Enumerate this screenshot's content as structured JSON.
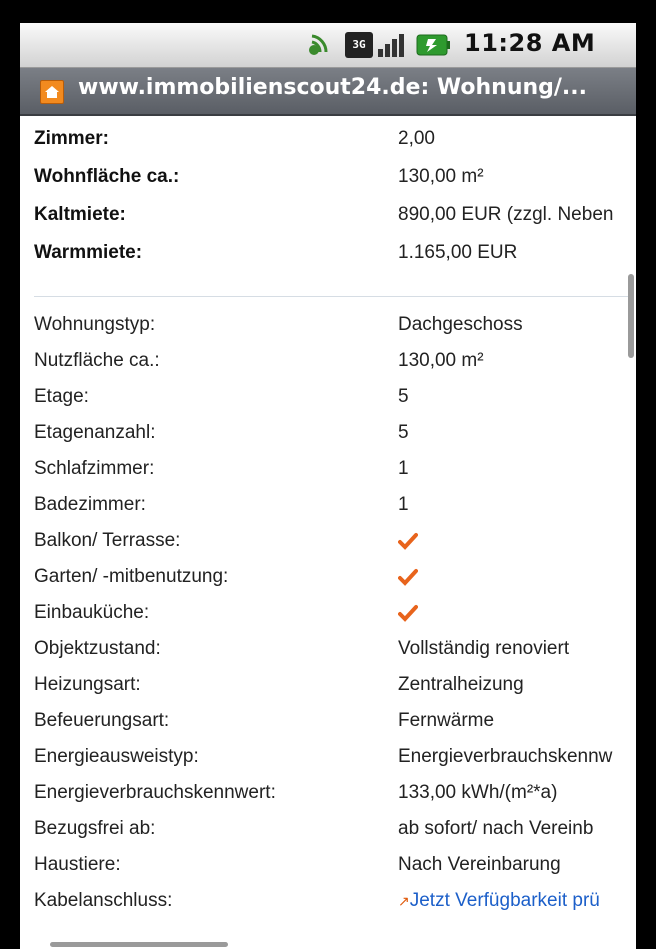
{
  "status_bar": {
    "time": "11:28 AM",
    "network": "3G"
  },
  "title_bar": {
    "title": "www.immobilienscout24.de: Wohnung/..."
  },
  "key_facts": [
    {
      "label": "Zimmer:",
      "value": "2,00"
    },
    {
      "label": "Wohnfläche ca.:",
      "value": "130,00 m²"
    },
    {
      "label": "Kaltmiete:",
      "value": "890,00 EUR (zzgl. Neben"
    },
    {
      "label": "Warmmiete:",
      "value": "1.165,00 EUR"
    }
  ],
  "details": [
    {
      "label": "Wohnungstyp:",
      "value": "Dachgeschoss"
    },
    {
      "label": "Nutzfläche ca.:",
      "value": "130,00 m²"
    },
    {
      "label": "Etage:",
      "value": "5"
    },
    {
      "label": "Etagenanzahl:",
      "value": "5"
    },
    {
      "label": "Schlafzimmer:",
      "value": "1"
    },
    {
      "label": "Badezimmer:",
      "value": "1"
    },
    {
      "label": "Balkon/ Terrasse:",
      "value": ""
    },
    {
      "label": "Garten/ -mitbenutzung:",
      "value": ""
    },
    {
      "label": "Einbauküche:",
      "value": ""
    },
    {
      "label": "Objektzustand:",
      "value": "Vollständig renoviert"
    },
    {
      "label": "Heizungsart:",
      "value": "Zentralheizung"
    },
    {
      "label": "Befeuerungsart:",
      "value": "Fernwärme"
    },
    {
      "label": "Energieausweistyp:",
      "value": "Energieverbrauchskennw"
    },
    {
      "label": "Energieverbrauchskennwert:",
      "value": "133,00 kWh/(m²*a)"
    },
    {
      "label": "Bezugsfrei ab:",
      "value": "ab sofort/ nach Vereinb"
    },
    {
      "label": "Haustiere:",
      "value": "Nach Vereinbarung"
    },
    {
      "label": "Kabelanschluss:",
      "value": "Jetzt Verfügbarkeit prü"
    }
  ],
  "check_icon": "checkmark-icon",
  "colors": {
    "check": "#e8641c",
    "link": "#1c5fc9"
  }
}
